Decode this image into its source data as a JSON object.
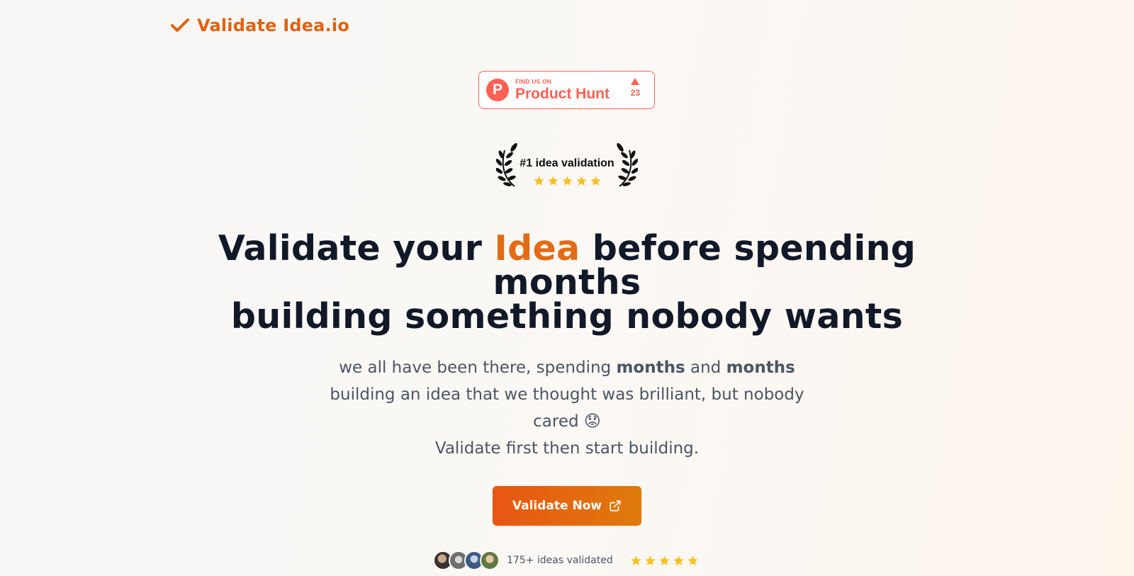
{
  "brand": {
    "name": "Validate Idea.io",
    "icon": "checkmark-icon",
    "color": "#e2620f"
  },
  "product_hunt": {
    "small_label": "FIND US ON",
    "big_label": "Product Hunt",
    "logo_letter": "P",
    "votes": "23",
    "color": "#ff6154"
  },
  "award": {
    "title": "#1 idea validation",
    "rating_stars": 5,
    "icon": "laurel-wreath-icon"
  },
  "hero": {
    "headline_part1": "Validate your ",
    "headline_accent": "Idea",
    "headline_part2": " before spending months",
    "headline_line2": "building something nobody wants",
    "sub_line1_a": "we all have been there, spending ",
    "sub_line1_b1": "months",
    "sub_line1_c": " and ",
    "sub_line1_b2": "months",
    "sub_line2": "building an idea that we thought was brilliant, but nobody cared 😟",
    "sub_line3": "Validate first then start building."
  },
  "cta": {
    "label": "Validate Now",
    "icon": "external-link-icon",
    "gradient_start": "#e85612",
    "gradient_end": "#df7a0b"
  },
  "social_proof": {
    "text": "175+ ideas validated",
    "avatar_count": 4,
    "rating_stars": 5,
    "star_color": "#fbbf24"
  }
}
